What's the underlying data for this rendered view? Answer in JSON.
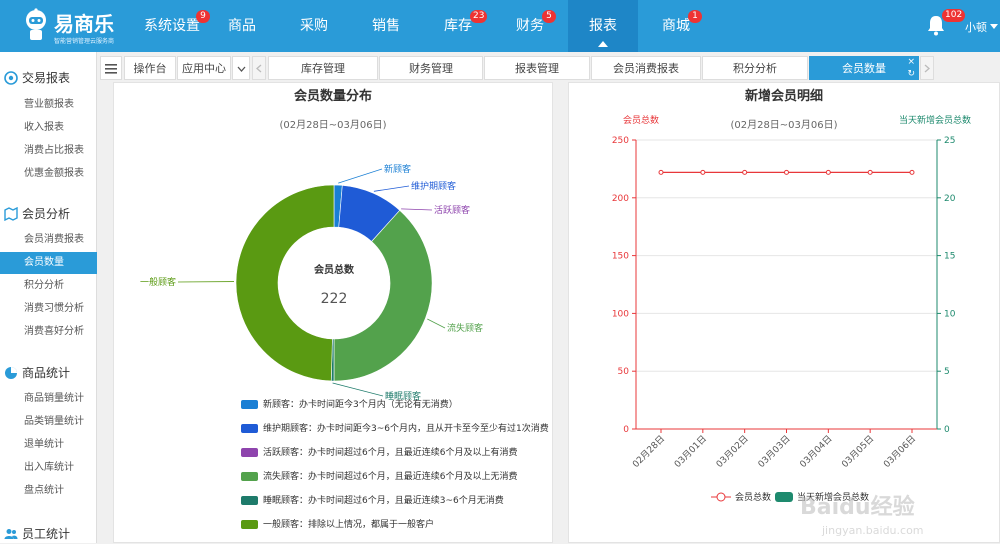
{
  "app": {
    "logo_text": "易商乐",
    "logo_subtitle": "智能营销管理云服务商"
  },
  "topnav": {
    "items": [
      {
        "label": "系统设置",
        "badge": "9"
      },
      {
        "label": "商品",
        "badge": ""
      },
      {
        "label": "采购",
        "badge": ""
      },
      {
        "label": "销售",
        "badge": ""
      },
      {
        "label": "库存",
        "badge": "23"
      },
      {
        "label": "财务",
        "badge": "5"
      },
      {
        "label": "报表",
        "badge": ""
      },
      {
        "label": "商城",
        "badge": "1"
      }
    ],
    "active": "报表",
    "bell_badge": "102",
    "user": "小顿"
  },
  "sidebar": {
    "sections": [
      {
        "title": "交易报表",
        "items": [
          "营业额报表",
          "收入报表",
          "消费占比报表",
          "优惠金额报表"
        ]
      },
      {
        "title": "会员分析",
        "items": [
          "会员消费报表",
          "会员数量",
          "积分分析",
          "消费习惯分析",
          "消费喜好分析"
        ]
      },
      {
        "title": "商品统计",
        "items": [
          "商品销量统计",
          "品类销量统计",
          "退单统计",
          "出入库统计",
          "盘点统计"
        ]
      },
      {
        "title": "员工统计",
        "items": []
      }
    ],
    "active_item": "会员数量"
  },
  "tabs": {
    "fixed": [
      "操作台",
      "应用中心"
    ],
    "items": [
      "库存管理",
      "财务管理",
      "报表管理",
      "会员消费报表",
      "积分分析",
      "会员数量"
    ],
    "active": "会员数量",
    "close_glyph": "×",
    "refresh_glyph": "↻"
  },
  "left_chart": {
    "title": "会员数量分布",
    "subtitle": "(02月28日~03月06日)",
    "center_label": "会员总数",
    "center_value": "222",
    "legend": [
      {
        "name": "新顾客",
        "desc": "新顾客：办卡时间距今3个月内（无论有无消费）",
        "color": "#1a7fd4"
      },
      {
        "name": "维护期顾客",
        "desc": "维护期顾客：办卡时间距今3~6个月内，且从开卡至今至少有过1次消费",
        "color": "#1f5bd6"
      },
      {
        "name": "活跃顾客",
        "desc": "活跃顾客：办卡时间超过6个月，且最近连续6个月及以上有消费",
        "color": "#8e44ad"
      },
      {
        "name": "流失顾客",
        "desc": "流失顾客：办卡时间超过6个月，且最近连续6个月及以上无消费",
        "color": "#53a24c"
      },
      {
        "name": "睡眠顾客",
        "desc": "睡眠顾客：办卡时间超过6个月，且最近连续3~6个月无消费",
        "color": "#1e7b6b"
      },
      {
        "name": "一般顾客",
        "desc": "一般顾客：排除以上情况，都属于一般客户",
        "color": "#5a9a12"
      }
    ]
  },
  "chart_data": [
    {
      "type": "pie",
      "title": "会员数量分布",
      "labels": [
        "新顾客",
        "维护期顾客",
        "活跃顾客",
        "流失顾客",
        "睡眠顾客",
        "一般顾客"
      ],
      "values": [
        3,
        23,
        0,
        85,
        1,
        110
      ]
    },
    {
      "type": "line",
      "title": "新增会员明细",
      "subtitle": "(02月28日~03月06日)",
      "categories": [
        "02月28日",
        "03月01日",
        "03月02日",
        "03月03日",
        "03月04日",
        "03月05日",
        "03月06日"
      ],
      "series": [
        {
          "name": "会员总数",
          "axis": "left",
          "values": [
            222,
            222,
            222,
            222,
            222,
            222,
            222
          ],
          "color": "#e8373a"
        },
        {
          "name": "当天新增会员总数",
          "axis": "right",
          "values": [
            0,
            0,
            0,
            0,
            0,
            0,
            0
          ],
          "color": "#1e8a6e"
        }
      ],
      "ylabel_left": "会员总数",
      "ylabel_right": "当天新增会员总数",
      "ylim_left": [
        0,
        250
      ],
      "ylim_right": [
        0,
        25
      ],
      "yticks_left": [
        0,
        50,
        100,
        150,
        200,
        250
      ],
      "yticks_right": [
        0,
        5,
        10,
        15,
        20,
        25
      ],
      "grid": true,
      "legend_position": "bottom-right"
    }
  ],
  "watermark": {
    "text1": "Baidu经验",
    "text2": "jingyan.baidu.com"
  }
}
